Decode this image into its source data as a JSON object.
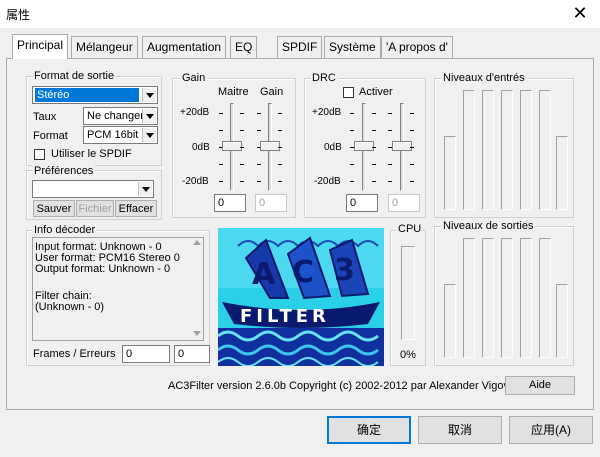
{
  "window": {
    "title": "属性"
  },
  "tabs": [
    {
      "label": "Principal",
      "active": true
    },
    {
      "label": "Mélangeur"
    },
    {
      "label": "Augmentation"
    },
    {
      "label": "EQ"
    },
    {
      "label": "SPDIF"
    },
    {
      "label": "Système"
    },
    {
      "label": "'A propos d'"
    }
  ],
  "output_format": {
    "legend": "Format de sortie",
    "channels_value": "Stéréo",
    "rate_label": "Taux",
    "rate_value": "Ne changer",
    "format_label": "Format",
    "format_value": "PCM 16bit",
    "spdif_label": "Utiliser le SPDIF"
  },
  "preferences": {
    "legend": "Préférences",
    "preset_value": "",
    "save_label": "Sauver",
    "file_label": "Fichier",
    "clear_label": "Effacer"
  },
  "gain": {
    "legend": "Gain",
    "master_label": "Maitre",
    "gain_label": "Gain",
    "db_top": "+20dB",
    "db_mid": "0dB",
    "db_bottom": "-20dB",
    "master_value": "0",
    "gain_value": "0"
  },
  "drc": {
    "legend": "DRC",
    "enable_label": "Activer",
    "db_top": "+20dB",
    "db_mid": "0dB",
    "db_bottom": "-20dB",
    "value1": "0",
    "value2": "0"
  },
  "input_levels": {
    "legend": "Niveaux d'entrés"
  },
  "output_levels": {
    "legend": "Niveaux de sorties"
  },
  "decoder_info": {
    "legend": "Info décoder",
    "lines": [
      "Input format: Unknown - 0",
      "User format: PCM16 Stereo 0",
      "Output format: Unknown - 0",
      "",
      "Filter chain:",
      "(Unknown - 0)"
    ],
    "frames_label": "Frames / Erreurs",
    "frames_value": "0",
    "errors_value": "0"
  },
  "logo": {
    "text": "AC3 FILTER"
  },
  "cpu": {
    "legend": "CPU",
    "value": "0%",
    "level": 0
  },
  "footer": {
    "version_text": "AC3Filter version 2.6.0b Copyright (c) 2002-2012 par Alexander Vigovsky",
    "help_label": "Aide"
  },
  "dialog_buttons": {
    "ok": "确定",
    "cancel": "取消",
    "apply": "应用(A)"
  },
  "colors": {
    "selection": "#0078d7",
    "logo_bg": "#2ad0e8",
    "logo_dark": "#0a1a6e"
  }
}
